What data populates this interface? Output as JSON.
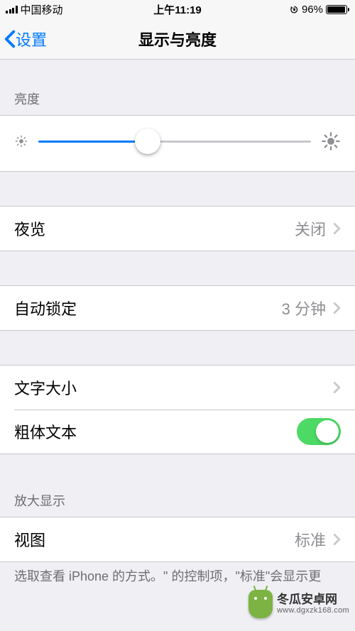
{
  "status": {
    "carrier": "中国移动",
    "time": "上午11:19",
    "battery_pct": "96%",
    "battery_fill_pct": 96
  },
  "nav": {
    "back": "设置",
    "title": "显示与亮度"
  },
  "brightness": {
    "header": "亮度",
    "value_pct": 40
  },
  "night_shift": {
    "label": "夜览",
    "value": "关闭"
  },
  "auto_lock": {
    "label": "自动锁定",
    "value": "3 分钟"
  },
  "text_size": {
    "label": "文字大小"
  },
  "bold_text": {
    "label": "粗体文本",
    "on": true
  },
  "zoom": {
    "header": "放大显示",
    "view_label": "视图",
    "view_value": "标准",
    "footer": "选取查看 iPhone 的方式。\"          的控制项，\"标准\"会显示更"
  },
  "watermark": {
    "name": "冬瓜安卓网",
    "url": "www.dgxzk168.com"
  }
}
